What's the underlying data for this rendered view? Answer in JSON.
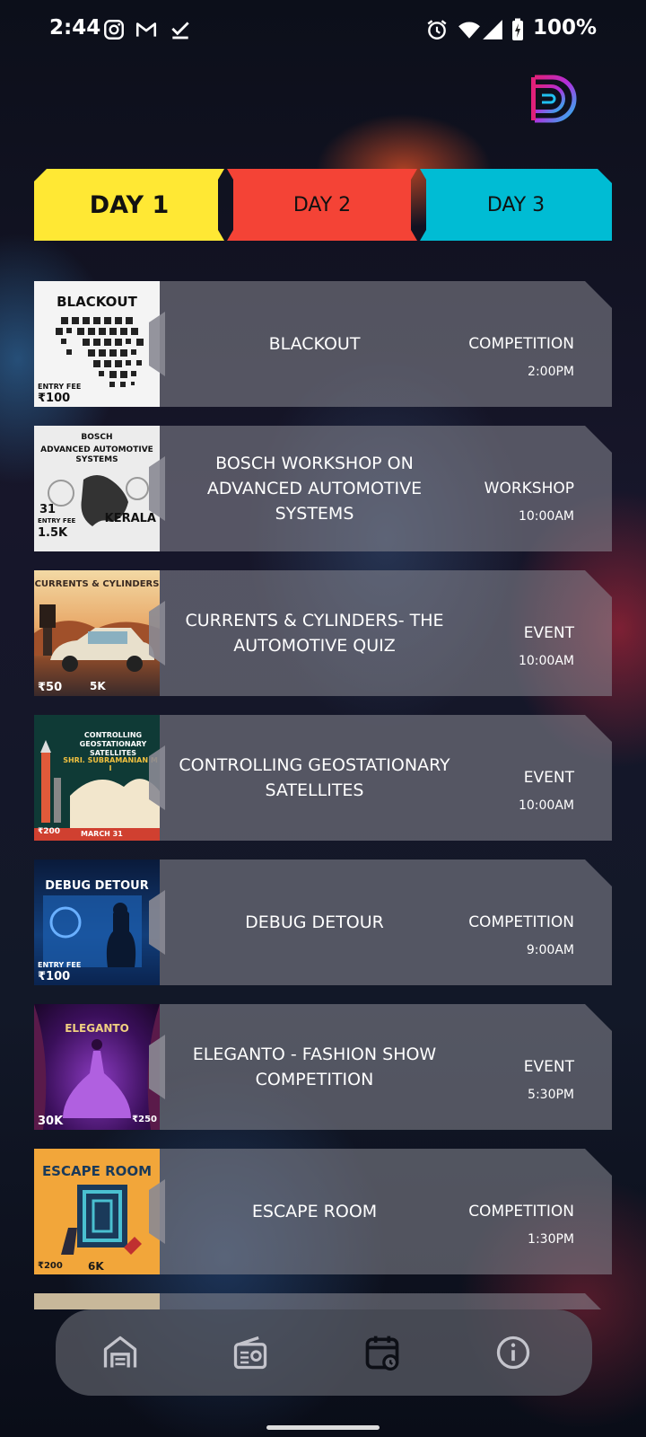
{
  "status_bar": {
    "time": "2:44",
    "battery": "100%"
  },
  "tabs": [
    {
      "label": "DAY 1",
      "selected": true
    },
    {
      "label": "DAY 2",
      "selected": false
    },
    {
      "label": "DAY 3",
      "selected": false
    }
  ],
  "events": [
    {
      "title": "BLACKOUT",
      "category": "COMPETITION",
      "time": "2:00PM",
      "poster": {
        "title": "BLACKOUT",
        "fee_label": "ENTRY FEE",
        "fee": "₹100"
      }
    },
    {
      "title": "BOSCH WORKSHOP ON ADVANCED AUTOMOTIVE SYSTEMS",
      "category": "WORKSHOP",
      "time": "10:00AM",
      "poster": {
        "title": "ADVANCED AUTOMOTIVE SYSTEMS",
        "fee_label": "ENTRY FEE",
        "fee": "1.5K",
        "extra": "KERALA"
      }
    },
    {
      "title": "CURRENTS & CYLINDERS- THE AUTOMOTIVE QUIZ",
      "category": "EVENT",
      "time": "10:00AM",
      "poster": {
        "title": "CURRENTS & CYLINDERS",
        "fee": "₹50",
        "extra": "5K"
      }
    },
    {
      "title": "CONTROLLING GEOSTATIONARY SATELLITES",
      "category": "EVENT",
      "time": "10:00AM",
      "poster": {
        "title": "CONTROLLING GEOSTATIONARY SATELLITES",
        "fee": "₹200",
        "extra": "MARCH 31"
      }
    },
    {
      "title": "DEBUG DETOUR",
      "category": "COMPETITION",
      "time": "9:00AM",
      "poster": {
        "title": "DEBUG DETOUR",
        "fee_label": "ENTRY FEE",
        "fee": "₹100"
      }
    },
    {
      "title": "ELEGANTO - FASHION SHOW COMPETITION",
      "category": "EVENT",
      "time": "5:30PM",
      "poster": {
        "title": "ELEGANTO",
        "fee": "30K",
        "extra": "₹250"
      }
    },
    {
      "title": "ESCAPE ROOM",
      "category": "COMPETITION",
      "time": "1:30PM",
      "poster": {
        "title": "ESCAPE ROOM",
        "fee": "₹200",
        "extra": "6K"
      }
    }
  ],
  "colors": {
    "day1": "#ffe834",
    "day2": "#f44336",
    "day3": "#00bcd4"
  },
  "nav": [
    {
      "icon": "home-icon"
    },
    {
      "icon": "radio-icon"
    },
    {
      "icon": "calendar-icon",
      "active": true
    },
    {
      "icon": "info-icon"
    }
  ]
}
